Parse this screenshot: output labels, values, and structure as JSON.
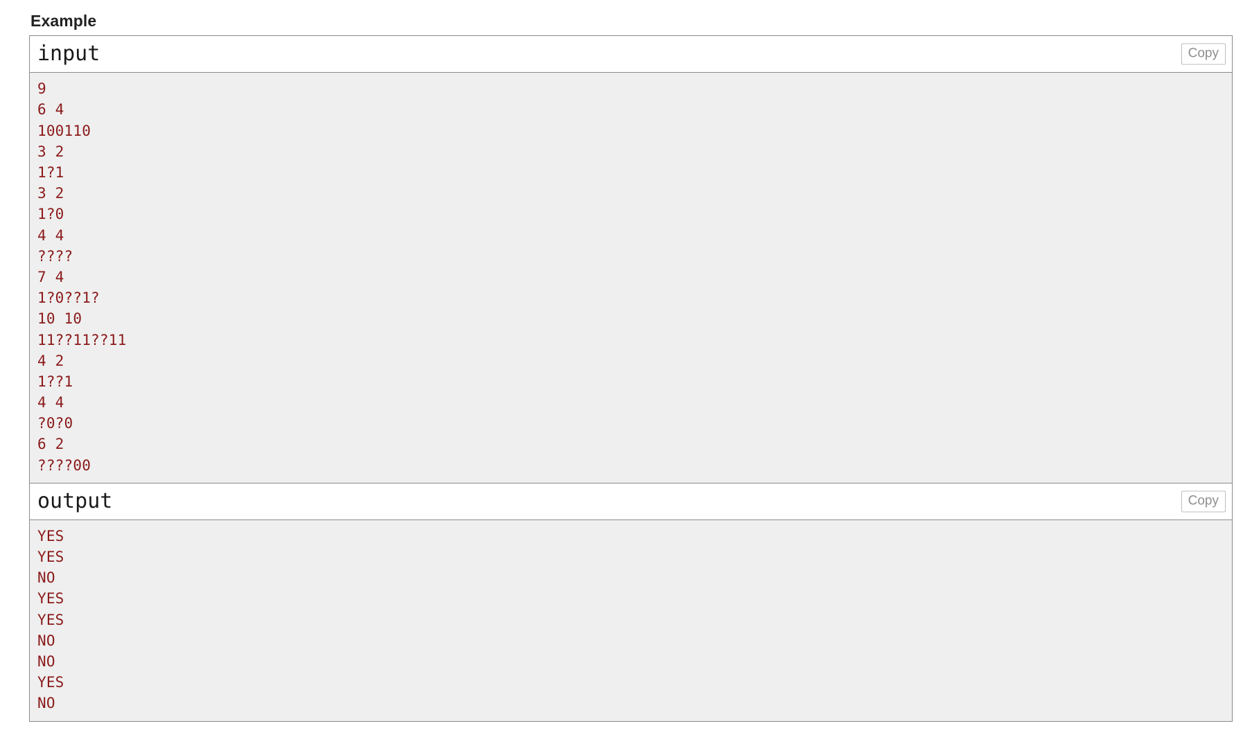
{
  "section": {
    "title": "Example"
  },
  "samples": [
    {
      "label": "input",
      "copy_label": "Copy",
      "lines": [
        "9",
        "6 4",
        "100110",
        "3 2",
        "1?1",
        "3 2",
        "1?0",
        "4 4",
        "????",
        "7 4",
        "1?0??1?",
        "10 10",
        "11??11??11",
        "4 2",
        "1??1",
        "4 4",
        "?0?0",
        "6 2",
        "????00"
      ]
    },
    {
      "label": "output",
      "copy_label": "Copy",
      "lines": [
        "YES",
        "YES",
        "NO",
        "YES",
        "YES",
        "NO",
        "NO",
        "YES",
        "NO"
      ]
    }
  ],
  "colors": {
    "code_text": "#8b1a1a",
    "panel_background": "#efefef",
    "border": "#8a8a8a",
    "copy_text": "#8e8e8e",
    "heading": "#212121"
  }
}
